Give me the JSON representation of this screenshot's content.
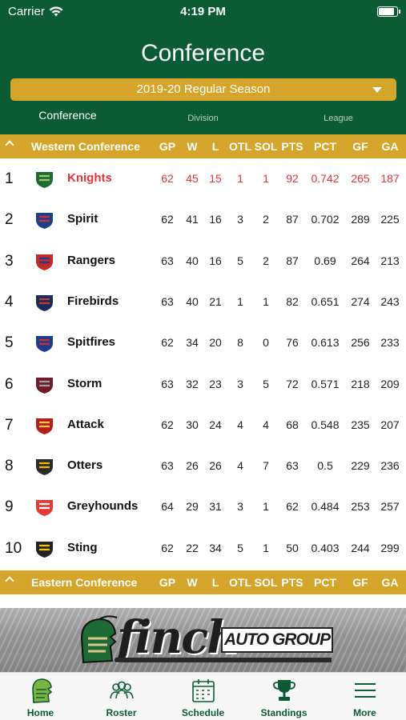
{
  "status": {
    "carrier": "Carrier",
    "time": "4:19 PM",
    "battery_percent": 85
  },
  "header": {
    "title": "Conference",
    "season": "2019-20 Regular Season",
    "segments": [
      "Conference",
      "Division",
      "League"
    ],
    "selected_segment": "Conference"
  },
  "columns": [
    "GP",
    "W",
    "L",
    "OTL",
    "SOL",
    "PTS",
    "PCT",
    "GF",
    "GA"
  ],
  "conferences": [
    {
      "name": "Western Conference",
      "teams": [
        {
          "rank": "1",
          "name": "Knights",
          "stats": [
            "62",
            "45",
            "15",
            "1",
            "1",
            "92",
            "0.742",
            "265",
            "187"
          ],
          "highlight": true,
          "logo": "knights-logo"
        },
        {
          "rank": "2",
          "name": "Spirit",
          "stats": [
            "62",
            "41",
            "16",
            "3",
            "2",
            "87",
            "0.702",
            "289",
            "225"
          ],
          "logo": "spirit-logo"
        },
        {
          "rank": "3",
          "name": "Rangers",
          "stats": [
            "63",
            "40",
            "16",
            "5",
            "2",
            "87",
            "0.69",
            "264",
            "213"
          ],
          "logo": "rangers-logo"
        },
        {
          "rank": "4",
          "name": "Firebirds",
          "stats": [
            "63",
            "40",
            "21",
            "1",
            "1",
            "82",
            "0.651",
            "274",
            "243"
          ],
          "logo": "firebirds-logo"
        },
        {
          "rank": "5",
          "name": "Spitfires",
          "stats": [
            "62",
            "34",
            "20",
            "8",
            "0",
            "76",
            "0.613",
            "256",
            "233"
          ],
          "logo": "spitfires-logo"
        },
        {
          "rank": "6",
          "name": "Storm",
          "stats": [
            "63",
            "32",
            "23",
            "3",
            "5",
            "72",
            "0.571",
            "218",
            "209"
          ],
          "logo": "storm-logo"
        },
        {
          "rank": "7",
          "name": "Attack",
          "stats": [
            "62",
            "30",
            "24",
            "4",
            "4",
            "68",
            "0.548",
            "235",
            "207"
          ],
          "logo": "attack-logo"
        },
        {
          "rank": "8",
          "name": "Otters",
          "stats": [
            "63",
            "26",
            "26",
            "4",
            "7",
            "63",
            "0.5",
            "229",
            "236"
          ],
          "logo": "otters-logo"
        },
        {
          "rank": "9",
          "name": "Greyhounds",
          "stats": [
            "64",
            "29",
            "31",
            "3",
            "1",
            "62",
            "0.484",
            "253",
            "257"
          ],
          "logo": "greyhounds-logo"
        },
        {
          "rank": "10",
          "name": "Sting",
          "stats": [
            "62",
            "22",
            "34",
            "5",
            "1",
            "50",
            "0.403",
            "244",
            "299"
          ],
          "logo": "sting-logo"
        }
      ]
    },
    {
      "name": "Eastern Conference",
      "teams": []
    }
  ],
  "banner": {
    "brand": "finch",
    "sub": "AUTO GROUP"
  },
  "tabs": [
    {
      "label": "Home",
      "icon": "helmet-icon"
    },
    {
      "label": "Roster",
      "icon": "people-icon"
    },
    {
      "label": "Schedule",
      "icon": "calendar-icon"
    },
    {
      "label": "Standings",
      "icon": "trophy-icon"
    },
    {
      "label": "More",
      "icon": "menu-icon"
    }
  ],
  "colors": {
    "primary": "#0b5c35",
    "accent": "#d4a52a",
    "highlight": "#e8333c"
  }
}
